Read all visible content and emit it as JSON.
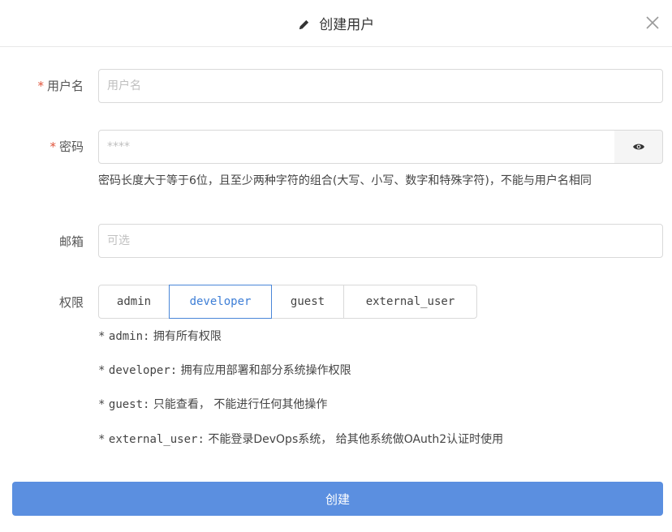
{
  "dialog": {
    "title": "创建用户",
    "title_icon": "pencil-icon",
    "close_icon": "close-icon"
  },
  "form": {
    "username": {
      "label": "用户名",
      "required_mark": "*",
      "placeholder": "用户名",
      "value": ""
    },
    "password": {
      "label": "密码",
      "required_mark": "*",
      "placeholder": "****",
      "value": "",
      "toggle_icon": "eye-icon",
      "hint": "密码长度大于等于6位，且至少两种字符的组合(大写、小写、数字和特殊字符)，不能与用户名相同"
    },
    "email": {
      "label": "邮箱",
      "placeholder": "可选",
      "value": ""
    },
    "role": {
      "label": "权限",
      "options": [
        "admin",
        "developer",
        "guest",
        "external_user"
      ],
      "selected": "developer",
      "descriptions": [
        {
          "bullet": "*",
          "name": "admin:",
          "text": "拥有所有权限"
        },
        {
          "bullet": "*",
          "name": "developer:",
          "text": "拥有应用部署和部分系统操作权限"
        },
        {
          "bullet": "*",
          "name": "guest:",
          "text": "只能查看，  不能进行任何其他操作"
        },
        {
          "bullet": "*",
          "name": "external_user:",
          "text": "不能登录DevOps系统，  给其他系统做OAuth2认证时使用"
        }
      ]
    }
  },
  "submit_label": "创建",
  "colors": {
    "primary": "#5b8fe0",
    "required": "#e0533a",
    "active_border": "#4a86d8"
  }
}
